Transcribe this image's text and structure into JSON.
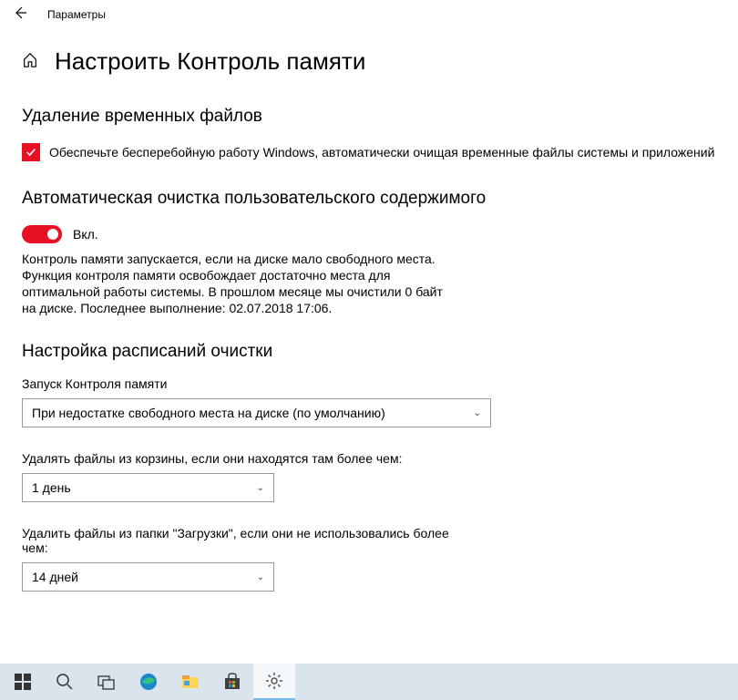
{
  "titlebar": {
    "title": "Параметры"
  },
  "page": {
    "title": "Настроить Контроль памяти"
  },
  "section_temp": {
    "heading": "Удаление временных файлов",
    "checkbox_label": "Обеспечьте бесперебойную работу Windows, автоматически очищая временные файлы системы и приложений"
  },
  "section_auto": {
    "heading": "Автоматическая очистка пользовательского содержимого",
    "toggle_label": "Вкл.",
    "description": "Контроль памяти запускается, если на диске мало свободного места. Функция контроля памяти освобождает достаточно места для оптимальной работы системы. В прошлом месяце мы очистили 0 байт на диске. Последнее выполнение: 02.07.2018 17:06."
  },
  "section_schedule": {
    "heading": "Настройка расписаний очистки",
    "run_label": "Запуск Контроля памяти",
    "run_value": "При недостатке свободного места на диске (по умолчанию)",
    "recycle_label": "Удалять файлы из корзины, если они находятся там более чем:",
    "recycle_value": "1 день",
    "downloads_label": "Удалить файлы из папки \"Загрузки\", если они не использовались более чем:",
    "downloads_value": "14 дней"
  }
}
